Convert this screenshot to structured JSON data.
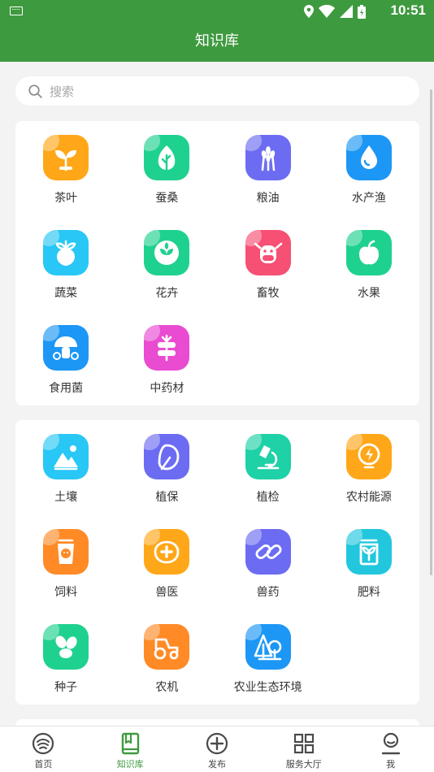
{
  "status_bar": {
    "time": "10:51"
  },
  "app_bar": {
    "title": "知识库"
  },
  "search": {
    "placeholder": "搜索"
  },
  "categories_primary": [
    {
      "label": "茶叶",
      "icon": "tea-sprout-icon",
      "color": "#FFA718"
    },
    {
      "label": "蚕桑",
      "icon": "mulberry-leaf-icon",
      "color": "#1FD18F"
    },
    {
      "label": "粮油",
      "icon": "wheat-icon",
      "color": "#6C6CF2"
    },
    {
      "label": "水产渔",
      "icon": "water-drop-icon",
      "color": "#1D97F5"
    },
    {
      "label": "蔬菜",
      "icon": "radish-icon",
      "color": "#28C7F5"
    },
    {
      "label": "花卉",
      "icon": "flower-icon",
      "color": "#1FD18F"
    },
    {
      "label": "畜牧",
      "icon": "cow-icon",
      "color": "#F65074"
    },
    {
      "label": "水果",
      "icon": "apple-icon",
      "color": "#1FD18F"
    },
    {
      "label": "食用菌",
      "icon": "mushroom-icon",
      "color": "#1D97F5"
    },
    {
      "label": "中药材",
      "icon": "herb-bundle-icon",
      "color": "#E94BD1"
    }
  ],
  "categories_secondary": [
    {
      "label": "土壤",
      "icon": "soil-mountain-icon",
      "color": "#28C7F5"
    },
    {
      "label": "植保",
      "icon": "leaf-shield-icon",
      "color": "#6C6CF2"
    },
    {
      "label": "植检",
      "icon": "microscope-icon",
      "color": "#1FD1A6"
    },
    {
      "label": "农村能源",
      "icon": "energy-bulb-icon",
      "color": "#FFA718"
    },
    {
      "label": "饲料",
      "icon": "feed-sack-icon",
      "color": "#FF8A26"
    },
    {
      "label": "兽医",
      "icon": "vet-pig-icon",
      "color": "#FFA718"
    },
    {
      "label": "兽药",
      "icon": "pill-icon",
      "color": "#6C6CF2"
    },
    {
      "label": "肥料",
      "icon": "fertilizer-bag-icon",
      "color": "#22C7DE"
    },
    {
      "label": "种子",
      "icon": "seeds-icon",
      "color": "#1FD18F"
    },
    {
      "label": "农机",
      "icon": "tractor-icon",
      "color": "#FF8A26"
    },
    {
      "label": "农业生态环境",
      "icon": "eco-tree-icon",
      "color": "#1D97F5"
    }
  ],
  "tab_bar": [
    {
      "label": "首页",
      "icon": "home-icon",
      "active": false
    },
    {
      "label": "知识库",
      "icon": "book-icon",
      "active": true
    },
    {
      "label": "发布",
      "icon": "plus-circle-icon",
      "active": false
    },
    {
      "label": "服务大厅",
      "icon": "grid-icon",
      "active": false
    },
    {
      "label": "我",
      "icon": "user-icon",
      "active": false
    }
  ],
  "colors": {
    "primary": "#3E9A3F",
    "background": "#F3F3F3"
  }
}
